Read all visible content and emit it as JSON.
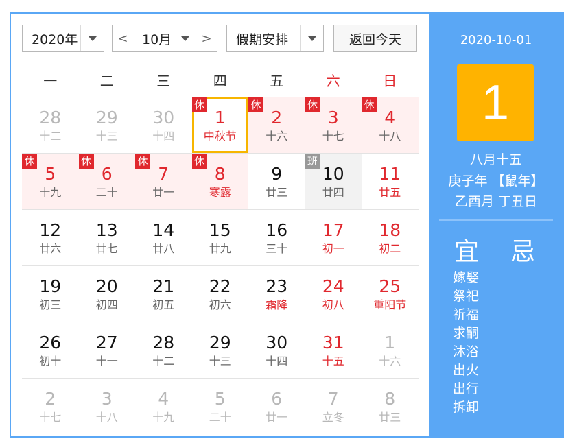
{
  "toolbar": {
    "year": "2020年",
    "month": "10月",
    "holiday": "假期安排",
    "prev": "<",
    "next": ">",
    "today": "返回今天"
  },
  "weekdays": [
    "一",
    "二",
    "三",
    "四",
    "五",
    "六",
    "日"
  ],
  "rest_badge": "休",
  "work_badge": "班",
  "weeks": [
    [
      {
        "d": "28",
        "l": "十二",
        "out": true
      },
      {
        "d": "29",
        "l": "十三",
        "out": true
      },
      {
        "d": "30",
        "l": "十四",
        "out": true
      },
      {
        "d": "1",
        "l": "中秋节",
        "rest": true,
        "festival": true,
        "selected": true
      },
      {
        "d": "2",
        "l": "十六",
        "rest": true
      },
      {
        "d": "3",
        "l": "十七",
        "rest": true
      },
      {
        "d": "4",
        "l": "十八",
        "rest": true
      }
    ],
    [
      {
        "d": "5",
        "l": "十九",
        "rest": true
      },
      {
        "d": "6",
        "l": "二十",
        "rest": true
      },
      {
        "d": "7",
        "l": "廿一",
        "rest": true
      },
      {
        "d": "8",
        "l": "寒露",
        "rest": true,
        "festival": true
      },
      {
        "d": "9",
        "l": "廿三"
      },
      {
        "d": "10",
        "l": "廿四",
        "work": true
      },
      {
        "d": "11",
        "l": "廿五",
        "weekend": true
      }
    ],
    [
      {
        "d": "12",
        "l": "廿六"
      },
      {
        "d": "13",
        "l": "廿七"
      },
      {
        "d": "14",
        "l": "廿八"
      },
      {
        "d": "15",
        "l": "廿九"
      },
      {
        "d": "16",
        "l": "三十"
      },
      {
        "d": "17",
        "l": "初一",
        "weekend": true
      },
      {
        "d": "18",
        "l": "初二",
        "weekend": true
      }
    ],
    [
      {
        "d": "19",
        "l": "初三"
      },
      {
        "d": "20",
        "l": "初四"
      },
      {
        "d": "21",
        "l": "初五"
      },
      {
        "d": "22",
        "l": "初六"
      },
      {
        "d": "23",
        "l": "霜降",
        "festival": true
      },
      {
        "d": "24",
        "l": "初八",
        "weekend": true
      },
      {
        "d": "25",
        "l": "重阳节",
        "weekend": true
      }
    ],
    [
      {
        "d": "26",
        "l": "初十"
      },
      {
        "d": "27",
        "l": "十一"
      },
      {
        "d": "28",
        "l": "十二"
      },
      {
        "d": "29",
        "l": "十三"
      },
      {
        "d": "30",
        "l": "十四"
      },
      {
        "d": "31",
        "l": "十五",
        "weekend": true
      },
      {
        "d": "1",
        "l": "十六",
        "out": true
      }
    ],
    [
      {
        "d": "2",
        "l": "十七",
        "out": true
      },
      {
        "d": "3",
        "l": "十八",
        "out": true
      },
      {
        "d": "4",
        "l": "十九",
        "out": true
      },
      {
        "d": "5",
        "l": "二十",
        "out": true
      },
      {
        "d": "6",
        "l": "廿一",
        "out": true
      },
      {
        "d": "7",
        "l": "立冬",
        "out": true
      },
      {
        "d": "8",
        "l": "廿三",
        "out": true
      }
    ]
  ],
  "panel": {
    "date": "2020-10-01",
    "day": "1",
    "lunar": "八月十五",
    "year_gz": "庚子年 【鼠年】",
    "month_day_gz": "乙酉月 丁丑日",
    "yi_label": "宜",
    "ji_label": "忌",
    "yi_items": [
      "嫁娶",
      "祭祀",
      "祈福",
      "求嗣",
      "沐浴",
      "出火",
      "出行",
      "拆卸"
    ]
  },
  "colors": {
    "accent": "#5aa7f5",
    "highlight": "#ffb300",
    "holiday_red": "#e0282e",
    "rest_bg": "#fff0f0"
  }
}
